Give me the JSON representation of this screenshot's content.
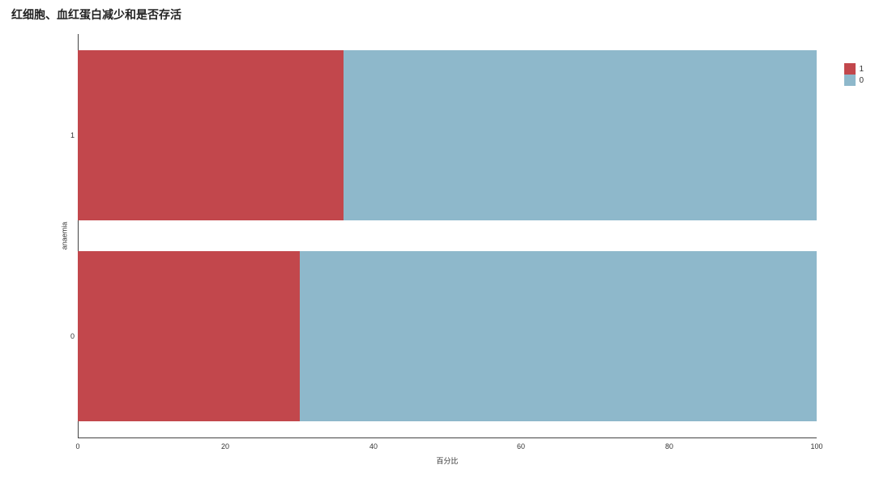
{
  "chart_data": {
    "type": "bar",
    "orientation": "horizontal",
    "stacked": true,
    "title": "红细胞、血红蛋白减少和是否存活",
    "xlabel": "百分比",
    "ylabel": "anaemia",
    "xlim": [
      0,
      100
    ],
    "xticks": [
      0,
      20,
      40,
      60,
      80,
      100
    ],
    "categories": [
      "1",
      "0"
    ],
    "series": [
      {
        "name": "1",
        "color": "#C2474C",
        "values": [
          36,
          30
        ]
      },
      {
        "name": "0",
        "color": "#8EB8CB",
        "values": [
          64,
          70
        ]
      }
    ],
    "legend": [
      "1",
      "0"
    ]
  },
  "colors": {
    "series1": "#C2474C",
    "series0": "#8EB8CB"
  }
}
